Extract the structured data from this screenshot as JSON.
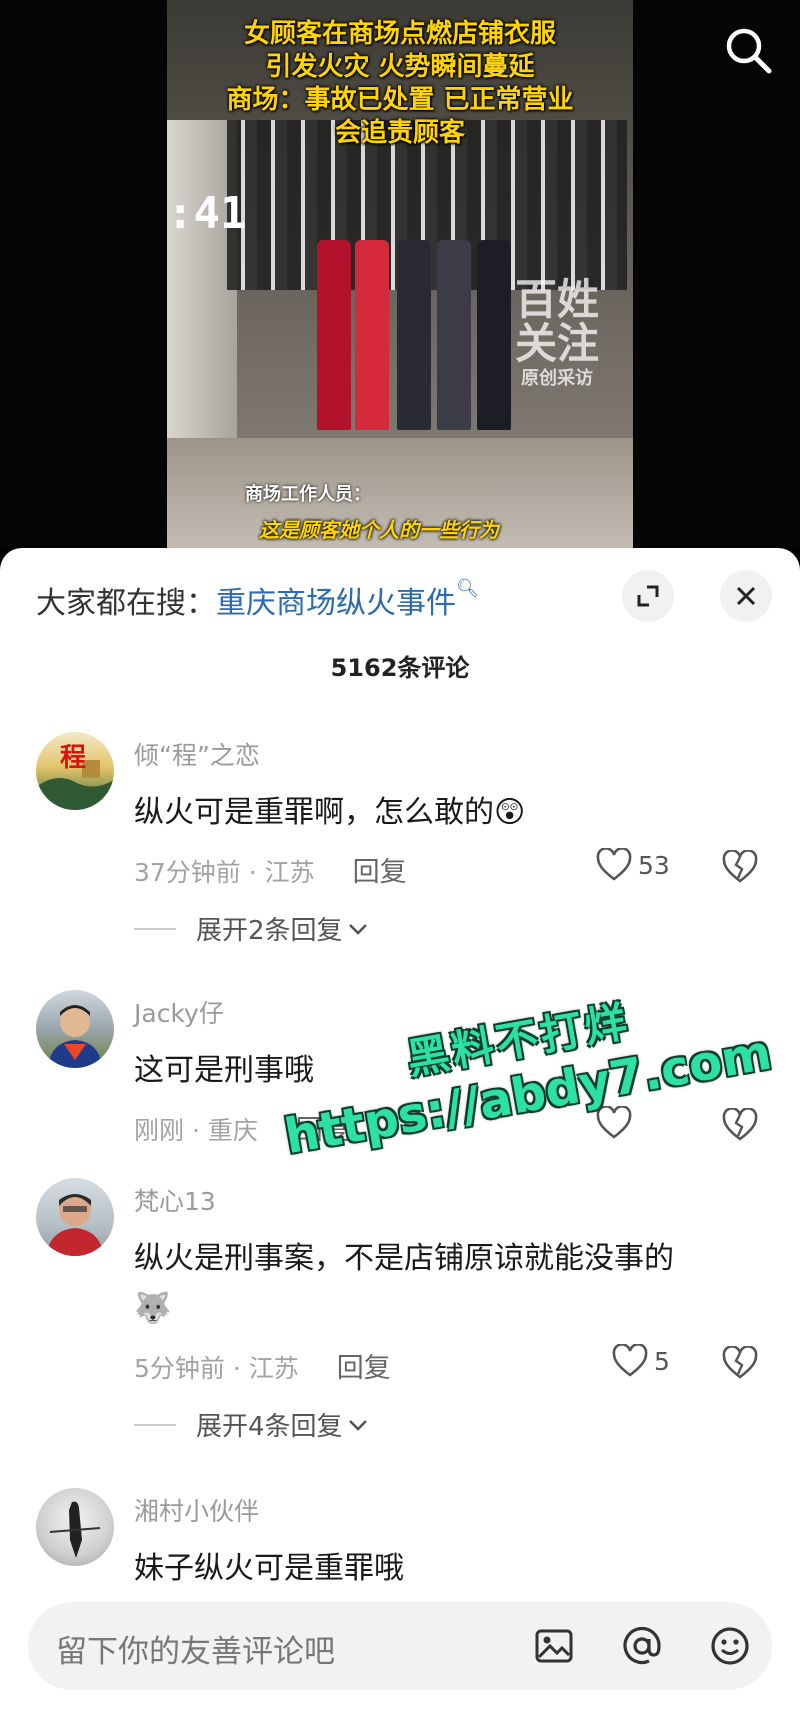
{
  "video": {
    "headline": [
      "女顾客在商场点燃店铺衣服",
      "引发火灾 火势瞬间蔓延",
      "商场：事故已处置 已正常营业",
      "会追责顾客"
    ],
    "clock_text": ":41",
    "watermark_big": [
      "百姓",
      "关注"
    ],
    "watermark_small": "原创采访",
    "subtitle_speaker": "商场工作人员：",
    "subtitle_line": "这是顾客她个人的一些行为"
  },
  "sheet": {
    "trend_prefix": "大家都在搜：",
    "trend_link": "重庆商场纵火事件",
    "comment_count": "5162条评论",
    "reply_label": "回复"
  },
  "comments": [
    {
      "author": "倾“程”之恋",
      "avatar_char": "程",
      "text": "纵火可是重罪啊，怎么敢的",
      "emoji": "😲",
      "meta": "37分钟前 · 江苏",
      "likes": "53",
      "expand": "展开2条回复"
    },
    {
      "author": "Jacky仔",
      "text": "这可是刑事哦",
      "meta": "刚刚 · 重庆",
      "likes": ""
    },
    {
      "author": "梵心13",
      "text": "纵火是刑事案，不是店铺原谅就能没事的",
      "emoji": "🐺",
      "meta": "5分钟前 · 江苏",
      "likes": "5",
      "expand": "展开4条回复"
    },
    {
      "author": "湘村小伙伴",
      "text": "妹子纵火可是重罪哦"
    }
  ],
  "overlay_ad": {
    "line1": "黑料不打烊",
    "line2": "https://abdy7.com"
  },
  "input": {
    "placeholder": "留下你的友善评论吧"
  },
  "colors": {
    "link": "#2b6cb0",
    "headline": "#ffd400",
    "overlay": "#2de0a3"
  },
  "icons": [
    "search-icon",
    "expand-icon",
    "close-icon",
    "heart-icon",
    "broken-heart-icon",
    "chevron-down-icon",
    "image-icon",
    "at-icon",
    "emoji-icon"
  ]
}
